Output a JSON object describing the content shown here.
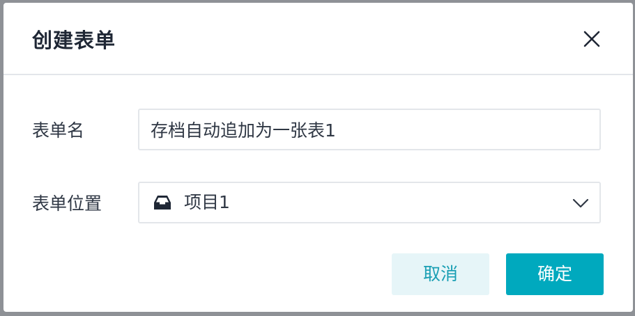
{
  "dialog": {
    "title": "创建表单",
    "close_icon": "close-icon"
  },
  "form": {
    "name_label": "表单名",
    "name_value": "存档自动追加为一张表1",
    "location_label": "表单位置",
    "location_value": "项目1",
    "location_icon": "inbox-tray-icon",
    "dropdown_icon": "chevron-down-icon"
  },
  "actions": {
    "cancel_label": "取消",
    "confirm_label": "确定"
  },
  "colors": {
    "accent": "#00a9be",
    "accent_light": "#e6f5f8",
    "overlay": "#8e9196"
  }
}
